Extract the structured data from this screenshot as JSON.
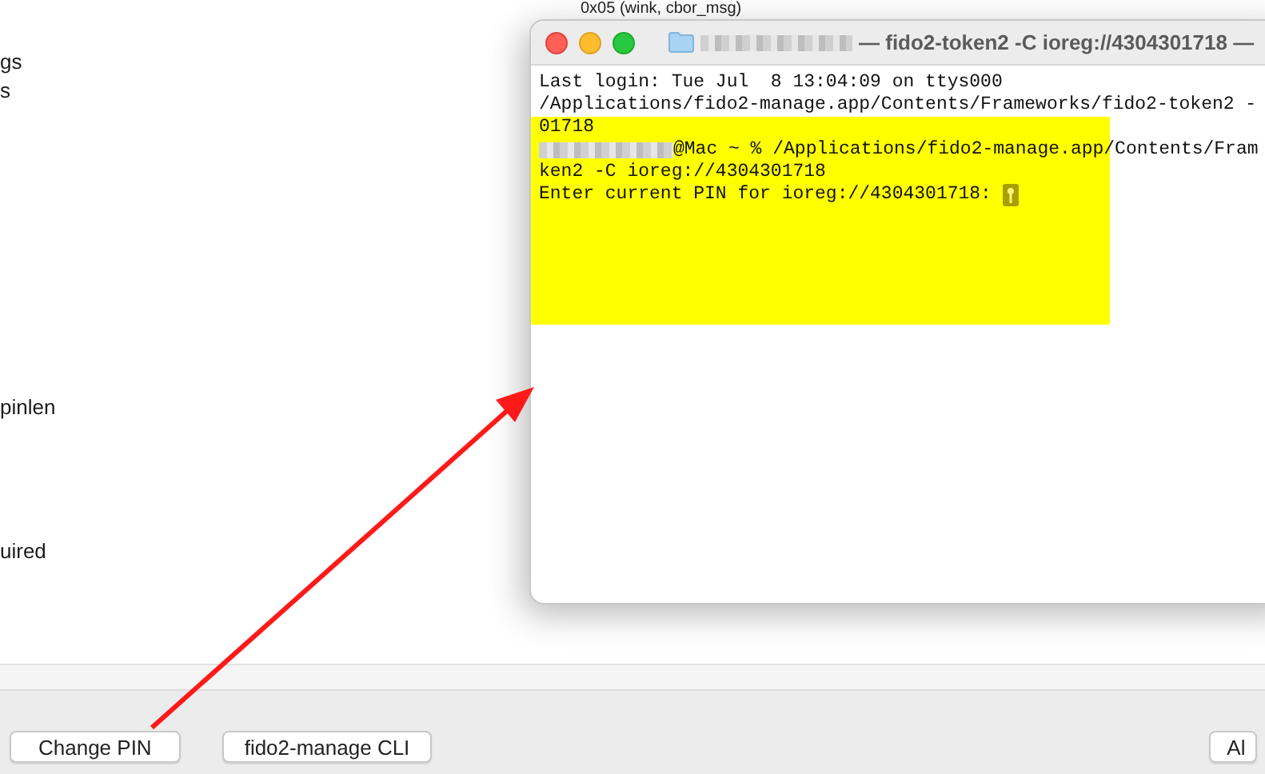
{
  "background_window": {
    "header_text": "0x05 (wink, cbor_msg)",
    "row_labels": [
      "gs",
      "s",
      "pinlen",
      "uired"
    ],
    "buttons": [
      {
        "label": "Change PIN"
      },
      {
        "label": "fido2-manage CLI"
      },
      {
        "label": "Al"
      }
    ]
  },
  "terminal": {
    "title": "— fido2-token2 -C ioreg://4304301718 —",
    "lines": [
      {
        "text": "Last login: Tue Jul  8 13:04:09 on ttys000",
        "highlighted": false
      },
      {
        "text": "/Applications/fido2-manage.app/Contents/Frameworks/fido2-token2 -",
        "highlighted": false
      },
      {
        "text": "01718",
        "highlighted": true
      },
      {
        "text": "@Mac ~ % /Applications/fido2-manage.app/Contents/Fram",
        "highlighted": true,
        "kind": "prompt"
      },
      {
        "text": "ken2 -C ioreg://4304301718",
        "highlighted": true
      },
      {
        "text": "Enter current PIN for ioreg://4304301718:",
        "highlighted": true,
        "kind": "password"
      }
    ]
  }
}
